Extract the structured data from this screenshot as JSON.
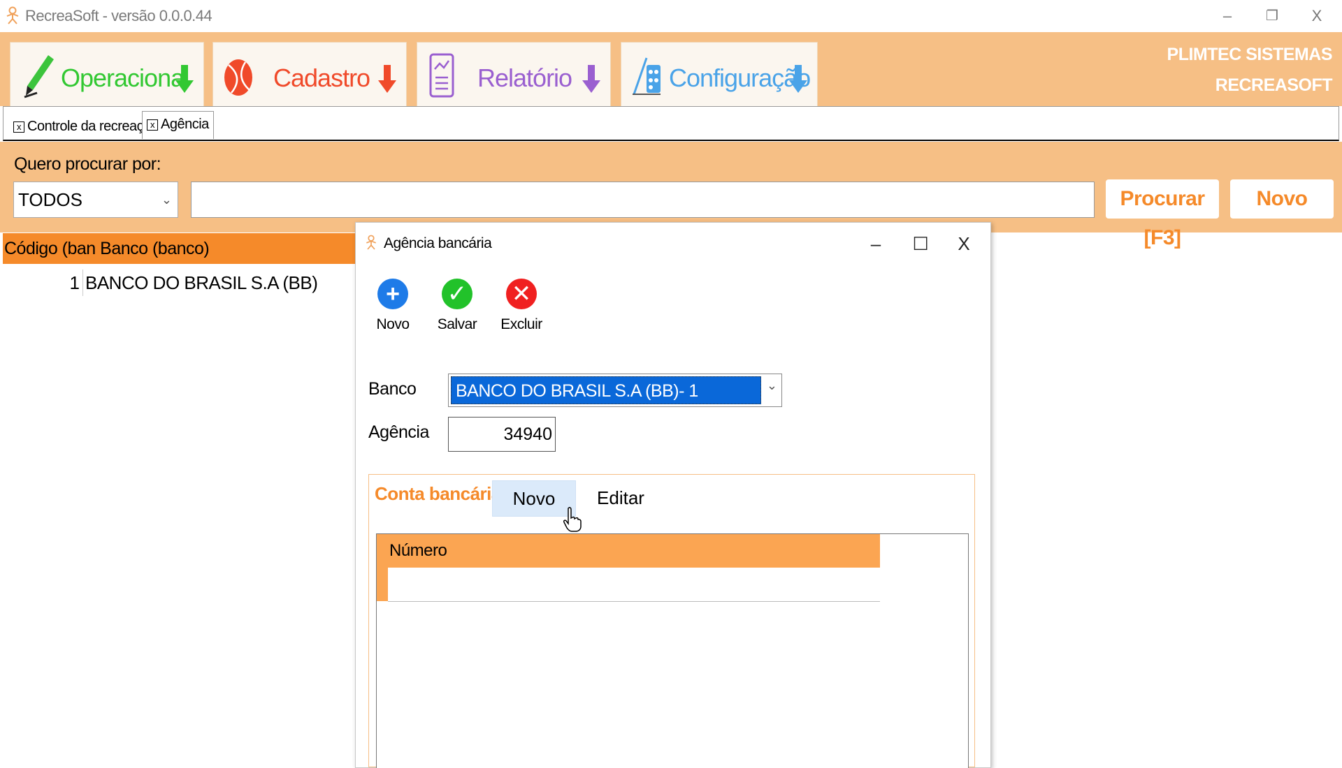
{
  "window": {
    "title": "RecreaSoft  -  versão 0.0.0.44",
    "controls": {
      "minimize": "–",
      "restore": "❐",
      "close": "X"
    }
  },
  "ribbon": {
    "tabs": [
      {
        "label": "Operacional",
        "color": "#32c832",
        "icon": "pencil-icon"
      },
      {
        "label": "Cadastro",
        "color": "#f04a2a",
        "icon": "ball-icon"
      },
      {
        "label": "Relatório",
        "color": "#9a5fd0",
        "icon": "report-icon"
      },
      {
        "label": "Configuração",
        "color": "#4aa3e8",
        "icon": "config-icon"
      }
    ],
    "brand_line1": "PLIMTEC SISTEMAS",
    "brand_line2": "RECREASOFT"
  },
  "doc_tabs": [
    {
      "label": "Controle da recreação",
      "close": "x"
    },
    {
      "label": "Agência",
      "close": "x"
    }
  ],
  "search": {
    "label": "Quero procurar por:",
    "filter_value": "TODOS",
    "query": "",
    "search_button": "Procurar [F3]",
    "new_button": "Novo"
  },
  "grid": {
    "header": "Código (ban Banco (banco)",
    "rows": [
      {
        "code": "1",
        "bank": "BANCO DO BRASIL S.A (BB)"
      }
    ]
  },
  "dialog": {
    "title": "Agência bancária",
    "controls": {
      "minimize": "–",
      "maximize": "☐",
      "close": "X"
    },
    "toolbar": {
      "new_label": "Novo",
      "save_label": "Salvar",
      "delete_label": "Excluir"
    },
    "banco_label": "Banco",
    "banco_value": "BANCO DO BRASIL S.A (BB)- 1",
    "agencia_label": "Agência",
    "agencia_value": "34940",
    "conta": {
      "title": "Conta bancária",
      "new_label": "Novo",
      "edit_label": "Editar",
      "column_header": "Número"
    }
  },
  "colors": {
    "accent_orange": "#f58a2a",
    "ribbon_bg": "#f6bf85",
    "selection_blue": "#0a68d9"
  }
}
